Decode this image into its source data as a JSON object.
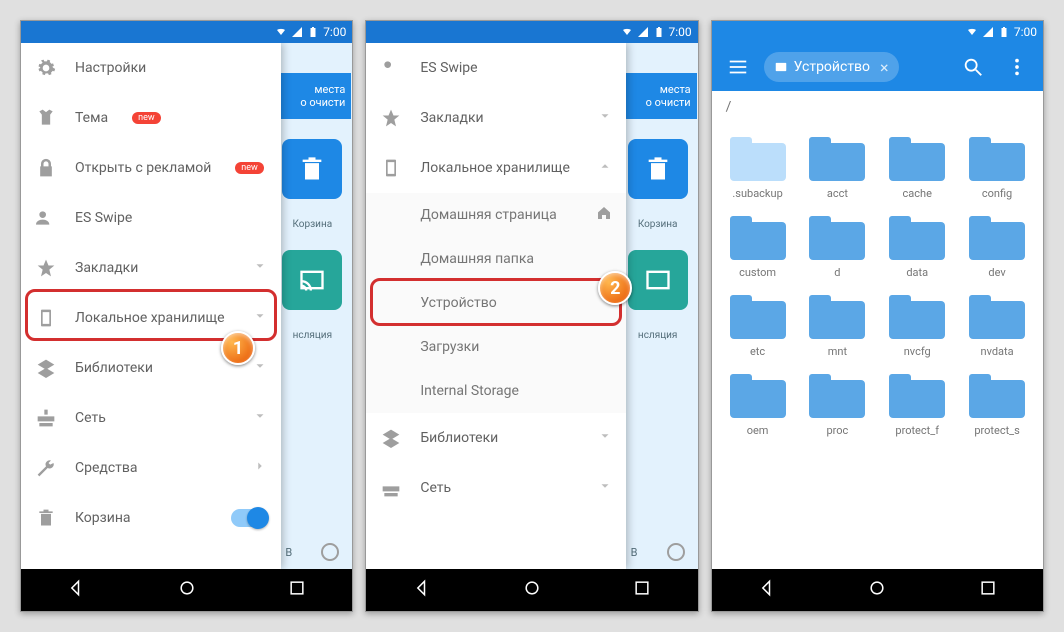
{
  "status": {
    "time": "7:00"
  },
  "phone1": {
    "behind": {
      "banner_l1": "места",
      "banner_l2": "о очисти",
      "tile1_label": "Корзина",
      "tile2_label": "нсляция",
      "bottom_text": "В"
    },
    "menu": {
      "settings": "Настройки",
      "theme": "Тема",
      "ads": "Открыть с рекламой",
      "swipe": "ES Swipe",
      "bookmarks": "Закладки",
      "local": "Локальное хранилище",
      "libraries": "Библиотеки",
      "network": "Сеть",
      "tools": "Средства",
      "trash": "Корзина",
      "new": "new"
    },
    "callout_num": "1"
  },
  "phone2": {
    "behind": {
      "banner_l1": "места",
      "banner_l2": "о очисти",
      "tile1_label": "Корзина",
      "tile2_label": "нсляция",
      "bottom_text": "В"
    },
    "menu": {
      "swipe": "ES Swipe",
      "bookmarks": "Закладки",
      "local": "Локальное хранилище",
      "home_page": "Домашняя страница",
      "home_folder": "Домашняя папка",
      "device": "Устройство",
      "downloads": "Загрузки",
      "internal": "Internal Storage",
      "libraries": "Библиотеки",
      "network": "Сеть"
    },
    "callout_num": "2"
  },
  "phone3": {
    "chip": "Устройство",
    "path": "/",
    "folders": [
      {
        "name": ".subackup",
        "light": true
      },
      {
        "name": "acct"
      },
      {
        "name": "cache"
      },
      {
        "name": "config"
      },
      {
        "name": "custom"
      },
      {
        "name": "d"
      },
      {
        "name": "data"
      },
      {
        "name": "dev"
      },
      {
        "name": "etc"
      },
      {
        "name": "mnt"
      },
      {
        "name": "nvcfg"
      },
      {
        "name": "nvdata"
      },
      {
        "name": "oem"
      },
      {
        "name": "proc"
      },
      {
        "name": "protect_f"
      },
      {
        "name": "protect_s"
      }
    ]
  }
}
